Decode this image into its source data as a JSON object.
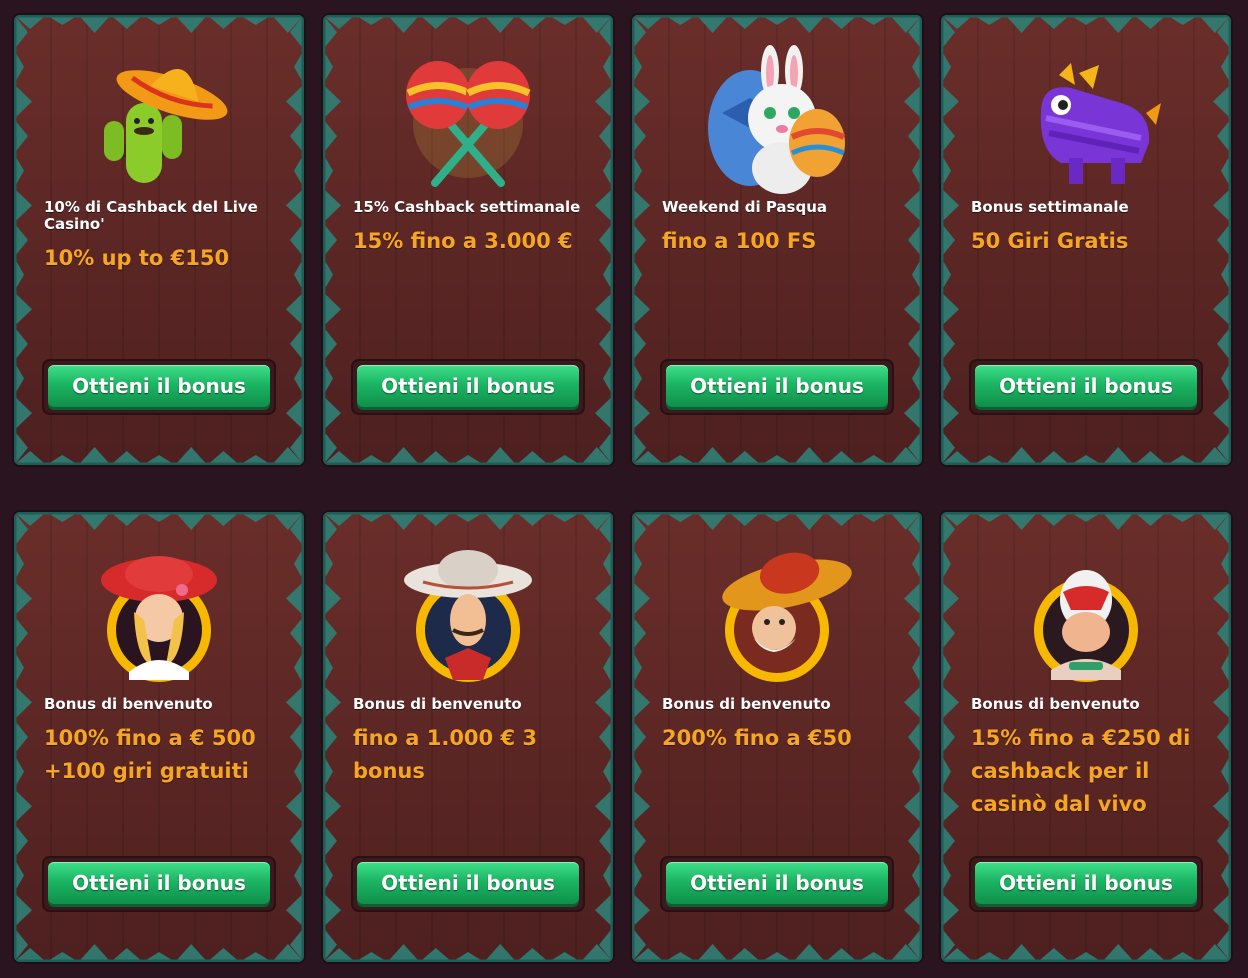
{
  "colors": {
    "page_background": "#2a1420",
    "card_wood": "#5a2624",
    "frame_teal": "#2f8075",
    "title_text": "#ffffff",
    "offer_text": "#f6a623",
    "button_green": "#1cb564",
    "medallion_gold": "#f6b800"
  },
  "cards": [
    {
      "title": "10% di Cashback del Live Casino'",
      "offer": "10% up to €150",
      "button_label": "Ottieni il bonus",
      "icon": "cactus-sombrero-icon"
    },
    {
      "title": "15% Cashback settimanale",
      "offer": "15% fino a 3.000 €",
      "button_label": "Ottieni il bonus",
      "icon": "maracas-icon"
    },
    {
      "title": "Weekend di Pasqua",
      "offer": "fino a 100 FS",
      "button_label": "Ottieni il bonus",
      "icon": "easter-bunny-icon"
    },
    {
      "title": "Bonus settimanale",
      "offer": "50 Giri Gratis",
      "button_label": "Ottieni il bonus",
      "icon": "pinata-icon"
    },
    {
      "title": "Bonus di benvenuto",
      "offer": "100% fino a € 500 +100 giri gratuiti",
      "button_label": "Ottieni il bonus",
      "icon": "senorita-avatar-icon"
    },
    {
      "title": "Bonus di benvenuto",
      "offer": "fino a 1.000 € 3 bonus",
      "button_label": "Ottieni il bonus",
      "icon": "mariachi-avatar-icon"
    },
    {
      "title": "Bonus di benvenuto",
      "offer": "200% fino a €50",
      "button_label": "Ottieni il bonus",
      "icon": "bandit-avatar-icon"
    },
    {
      "title": "Bonus di benvenuto",
      "offer": "15% fino a €250 di cashback per il casinò dal vivo",
      "button_label": "Ottieni il bonus",
      "icon": "luchador-avatar-icon"
    }
  ]
}
